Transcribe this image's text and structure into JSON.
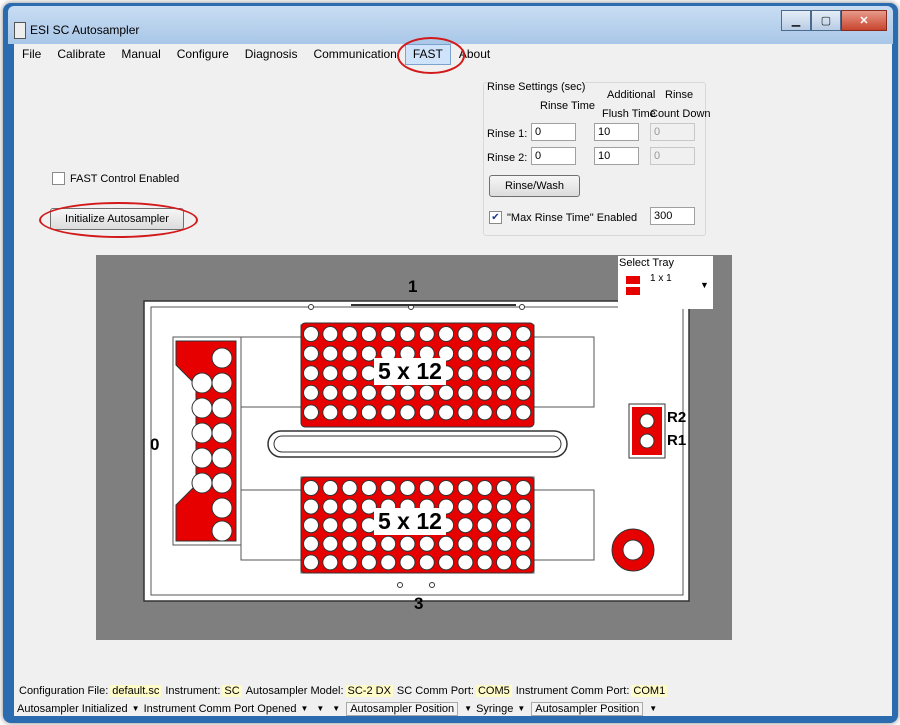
{
  "window": {
    "title": "ESI SC Autosampler",
    "minimize": "▁",
    "maximize": "▢",
    "close": "✕"
  },
  "menu": [
    "File",
    "Calibrate",
    "Manual",
    "Configure",
    "Diagnosis",
    "Communication",
    "FAST",
    "About"
  ],
  "fast_control": {
    "label": "FAST Control Enabled",
    "checked": false
  },
  "init_button": "Initialize Autosampler",
  "rinse": {
    "title": "Rinse Settings (sec)",
    "col_rinse_time": "Rinse Time",
    "col_additional": "Additional",
    "col_flush": "Flush Time",
    "col_rinse": "Rinse",
    "col_countdown": "Count Down",
    "rinse1_label": "Rinse 1:",
    "rinse1_time": "0",
    "rinse1_flush": "10",
    "rinse1_count": "0",
    "rinse2_label": "Rinse 2:",
    "rinse2_time": "0",
    "rinse2_flush": "10",
    "rinse2_count": "0",
    "wash_button": "Rinse/Wash",
    "max_label": "\"Max Rinse Time\" Enabled",
    "max_value": "300",
    "max_checked": true
  },
  "tray": {
    "select_label": "Select Tray",
    "selected": "1 x 1",
    "pos_top": "1",
    "pos_left": "0",
    "pos_bottom": "3",
    "rack_top": "5 x 12",
    "rack_bottom": "5 x 12",
    "r2": "R2",
    "r1": "R1"
  },
  "status1": {
    "config_label": "Configuration File:",
    "config_value": "default.sc",
    "instrument_label": "Instrument:",
    "instrument_value": "SC",
    "model_label": "Autosampler Model:",
    "model_value": "SC-2 DX",
    "sccomm_label": "SC Comm Port:",
    "sccomm_value": "COM5",
    "instcomm_label": "Instrument Comm Port:",
    "instcomm_value": "COM1"
  },
  "status2": {
    "s1": "Autosampler Initialized",
    "s2": "Instrument Comm Port Opened",
    "s3": "Autosampler Position",
    "s4": "Syringe",
    "s5": "Autosampler Position"
  },
  "colors": {
    "red": "#e60000",
    "highlight": "#d21a1a",
    "title_blue": "#a9c7e8"
  }
}
